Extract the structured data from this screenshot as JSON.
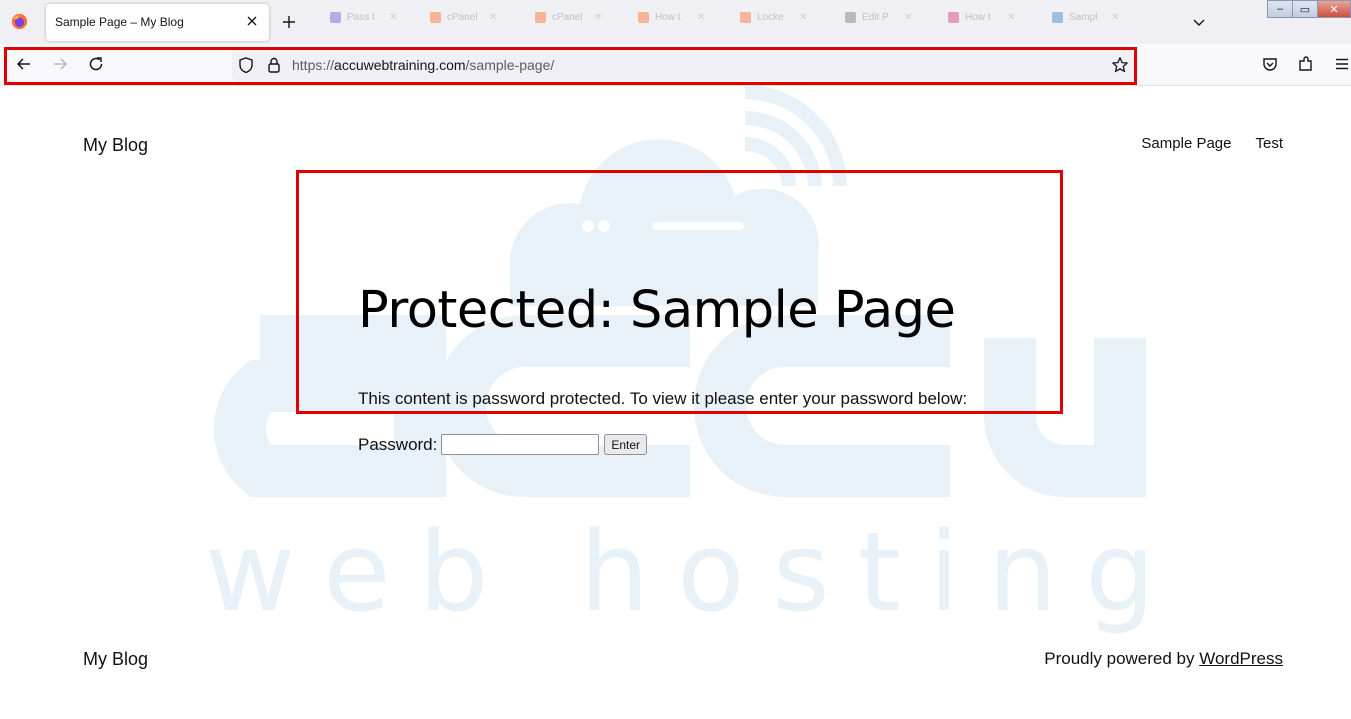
{
  "browser": {
    "active_tab": {
      "title": "Sample Page – My Blog",
      "close_icon": "close-icon"
    },
    "background_tabs": [
      {
        "label": "Pass t",
        "color": "#6b5bd6"
      },
      {
        "label": "cPanel",
        "color": "#ff6c2c"
      },
      {
        "label": "cPanel",
        "color": "#ff6c2c"
      },
      {
        "label": "How t",
        "color": "#ff6c2c"
      },
      {
        "label": "Locke",
        "color": "#ff6c2c"
      },
      {
        "label": "Edit P",
        "color": "#777777"
      },
      {
        "label": "How t",
        "color": "#d63a6a"
      },
      {
        "label": "Sampl",
        "color": "#3d82c6"
      }
    ],
    "window_controls": {
      "minimize": "–",
      "restore": "▭",
      "close": "✕"
    },
    "url": {
      "scheme": "https://",
      "host": "accuwebtraining.com",
      "path": "/sample-page/"
    },
    "icons": [
      "back-arrow-icon",
      "forward-arrow-icon",
      "reload-icon",
      "shield-icon",
      "lock-icon",
      "star-icon",
      "pocket-icon",
      "extensions-icon",
      "menu-icon"
    ],
    "highlight_color": "#e00000"
  },
  "watermark": {
    "brand": "accu",
    "tagline": "w e b   h o s t i n g",
    "color": "#e8f0f8"
  },
  "site": {
    "title": "My Blog",
    "nav": [
      "Sample Page",
      "Test"
    ]
  },
  "content": {
    "title": "Protected: Sample Page",
    "message": "This content is password protected. To view it please enter your password below:",
    "password_label": "Password:",
    "password_value": "",
    "submit_label": "Enter"
  },
  "footer": {
    "title": "My Blog",
    "credit_prefix": "Proudly powered by ",
    "credit_link": "WordPress"
  }
}
